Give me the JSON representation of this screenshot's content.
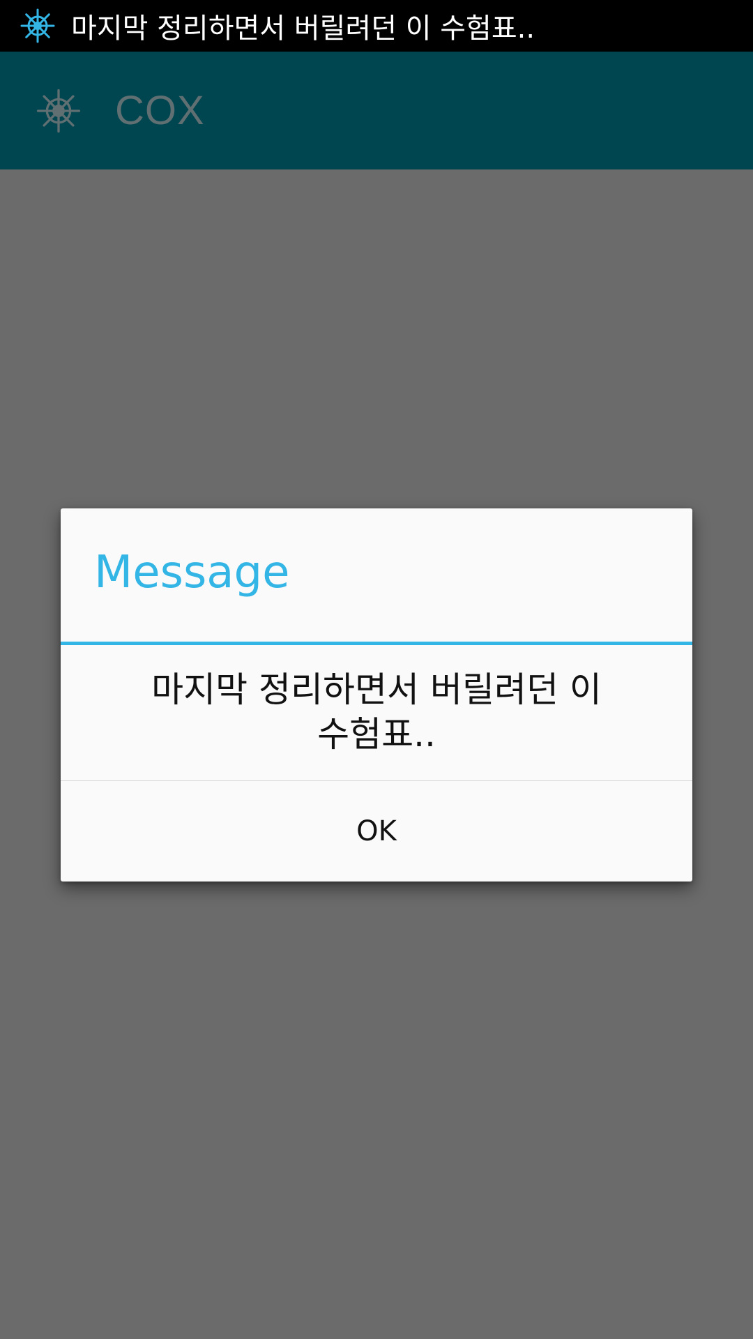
{
  "status_bar": {
    "notification_icon": "ship-wheel-icon",
    "notification_text": "마지막 정리하면서 버릴려던 이 수험표..",
    "icon_color": "#33b5e5"
  },
  "app_bar": {
    "icon": "ship-wheel-icon",
    "title": "COX",
    "background_color": "#004650"
  },
  "dialog": {
    "title": "Message",
    "message_line1": "마지막 정리하면서 버릴려던 이",
    "message_line2": "수험표..",
    "ok_label": "OK",
    "accent_color": "#33b5e5"
  },
  "scrim_color": "#6b6b6b"
}
